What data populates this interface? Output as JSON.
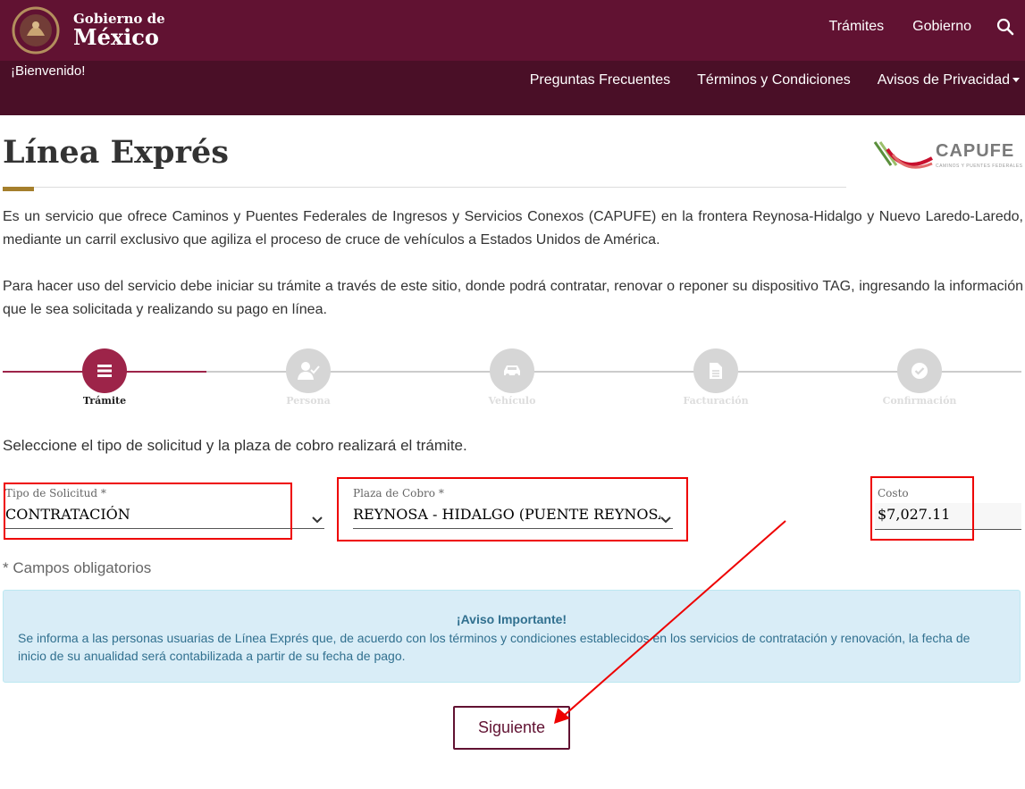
{
  "header": {
    "logo_small": "Gobierno de",
    "logo_big": "México",
    "nav": [
      "Trámites",
      "Gobierno"
    ]
  },
  "subheader": {
    "welcome": "¡Bienvenido!",
    "nav": [
      "Preguntas Frecuentes",
      "Términos y Condiciones",
      "Avisos de Privacidad"
    ]
  },
  "page": {
    "title": "Línea Exprés",
    "capufe_word": "CAPUFE",
    "capufe_tagline": "CAMINOS Y PUENTES FEDERALES",
    "intro_1": "Es un servicio que ofrece Caminos y Puentes Federales de Ingresos y Servicios Conexos (CAPUFE) en la frontera Reynosa-Hidalgo y Nuevo Laredo-Laredo, mediante un carril exclusivo que agiliza el proceso de cruce de vehículos a Estados Unidos de América.",
    "intro_2": "Para hacer uso del servicio debe iniciar su trámite a través de este sitio, donde podrá contratar, renovar o reponer su dispositivo TAG, ingresando la información que le sea solicitada y realizando su pago en línea."
  },
  "stepper": {
    "steps": [
      {
        "label": "Trámite",
        "icon": "menu-icon",
        "active": true
      },
      {
        "label": "Persona",
        "icon": "person-check-icon",
        "active": false
      },
      {
        "label": "Vehículo",
        "icon": "car-icon",
        "active": false
      },
      {
        "label": "Facturación",
        "icon": "document-icon",
        "active": false
      },
      {
        "label": "Confirmación",
        "icon": "check-circle-icon",
        "active": false
      }
    ]
  },
  "form": {
    "instructions": "Seleccione el tipo de solicitud y la plaza de cobro realizará el trámite.",
    "tipo_label": "Tipo de Solicitud *",
    "tipo_value": "CONTRATACIÓN",
    "plaza_label": "Plaza de Cobro *",
    "plaza_value": "REYNOSA - HIDALGO (PUENTE REYNOSA)",
    "costo_label": "Costo",
    "costo_value": "$7,027.11",
    "required_note": "* Campos obligatorios"
  },
  "alert": {
    "title": "¡Aviso Importante!",
    "body": "Se informa a las personas usuarias de Línea Exprés que, de acuerdo con los términos y condiciones establecidos en los servicios de contratación y renovación, la fecha de inicio de su anualidad será contabilizada a partir de su fecha de pago."
  },
  "actions": {
    "next_label": "Siguiente"
  },
  "colors": {
    "brand": "#611232",
    "brand_dark": "#4a0f27",
    "accent": "#9d2449",
    "gold": "#a57f2c",
    "annotation_red": "#e00000"
  }
}
